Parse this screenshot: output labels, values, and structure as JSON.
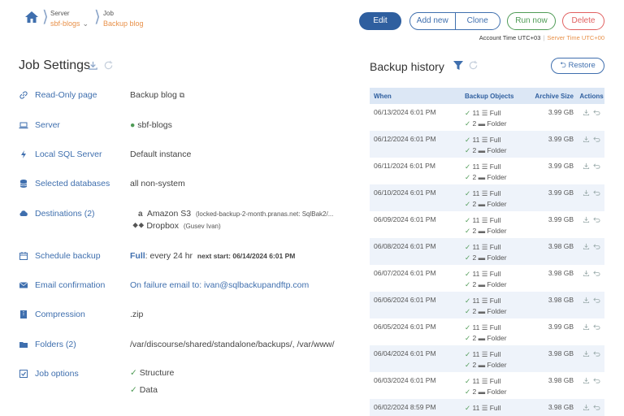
{
  "breadcrumb": {
    "server_label": "Server",
    "server_value": "sbf-blogs",
    "job_label": "Job",
    "job_value": "Backup blog"
  },
  "toolbar": {
    "edit": "Edit",
    "add_new": "Add new",
    "clone": "Clone",
    "run_now": "Run now",
    "delete": "Delete"
  },
  "time": {
    "account": "Account Time UTC+03",
    "server": "Server Time UTC+00"
  },
  "job_settings": {
    "title": "Job Settings",
    "rows": [
      {
        "label": "Read-Only page",
        "value": "Backup blog"
      },
      {
        "label": "Server",
        "value": "sbf-blogs"
      },
      {
        "label": "Local SQL Server",
        "value": "Default instance"
      },
      {
        "label": "Selected databases",
        "value": "all non-system"
      },
      {
        "label": "Destinations (2)",
        "dest1": "Amazon S3",
        "dest1_detail": "(locked-backup-2-month.pranas.net: SqlBak2/...",
        "dest2": "Dropbox",
        "dest2_detail": "(Gusev Ivan)"
      },
      {
        "label": "Schedule backup",
        "full": "Full",
        "every": ": every 24 hr",
        "next": "next start: 06/14/2024 6:01 PM"
      },
      {
        "label": "Email confirmation",
        "value": "On failure email to:  ivan@sqlbackupandftp.com"
      },
      {
        "label": "Compression",
        "value": ".zip"
      },
      {
        "label": "Folders (2)",
        "value": "/var/discourse/shared/standalone/backups/,  /var/www/"
      },
      {
        "label": "Job options",
        "opt1": "Structure",
        "opt2": "Data"
      }
    ]
  },
  "backup_history": {
    "title": "Backup history",
    "restore": "Restore",
    "columns": [
      "When",
      "Backup Objects",
      "Archive Size",
      "Actions"
    ],
    "full_label": "Full",
    "folder_label": "Folder",
    "rows": [
      {
        "when": "06/13/2024  6:01 PM",
        "full": "11",
        "folder": "2",
        "size": "3.99 GB"
      },
      {
        "when": "06/12/2024  6:01 PM",
        "full": "11",
        "folder": "2",
        "size": "3.99 GB"
      },
      {
        "when": "06/11/2024  6:01 PM",
        "full": "11",
        "folder": "2",
        "size": "3.99 GB"
      },
      {
        "when": "06/10/2024  6:01 PM",
        "full": "11",
        "folder": "2",
        "size": "3.99 GB"
      },
      {
        "when": "06/09/2024  6:01 PM",
        "full": "11",
        "folder": "2",
        "size": "3.99 GB"
      },
      {
        "when": "06/08/2024  6:01 PM",
        "full": "11",
        "folder": "2",
        "size": "3.98 GB"
      },
      {
        "when": "06/07/2024  6:01 PM",
        "full": "11",
        "folder": "2",
        "size": "3.98 GB"
      },
      {
        "when": "06/06/2024  6:01 PM",
        "full": "11",
        "folder": "2",
        "size": "3.98 GB"
      },
      {
        "when": "06/05/2024  6:01 PM",
        "full": "11",
        "folder": "2",
        "size": "3.99 GB"
      },
      {
        "when": "06/04/2024  6:01 PM",
        "full": "11",
        "folder": "2",
        "size": "3.98 GB"
      },
      {
        "when": "06/03/2024  6:01 PM",
        "full": "11",
        "folder": "2",
        "size": "3.98 GB"
      },
      {
        "when": "06/02/2024  8:59 PM",
        "full": "11",
        "folder": "",
        "size": "3.98 GB"
      }
    ]
  },
  "colors": {
    "accent": "#2f5f9f",
    "orange": "#e8914a",
    "green": "#4f9b56",
    "red": "#e16060"
  }
}
